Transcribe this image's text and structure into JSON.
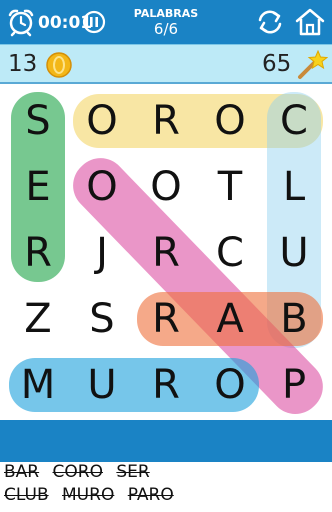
{
  "header": {
    "timer": "00:01",
    "label": "PALABRAS",
    "progress": "6/6"
  },
  "stats": {
    "coins": "13",
    "hints": "65"
  },
  "grid": {
    "rows": [
      [
        "S",
        "O",
        "R",
        "O",
        "C"
      ],
      [
        "E",
        "O",
        "O",
        "T",
        "L"
      ],
      [
        "R",
        "J",
        "R",
        "C",
        "U"
      ],
      [
        "Z",
        "S",
        "R",
        "A",
        "B"
      ],
      [
        "M",
        "U",
        "R",
        "O",
        "P"
      ]
    ]
  },
  "highlights": [
    {
      "word": "SER",
      "color": "#2eaa55"
    },
    {
      "word": "CORO",
      "color": "#f2cd4a"
    },
    {
      "word": "CLUB",
      "color": "#8fd0ef"
    },
    {
      "word": "PARO",
      "color": "#d9409b"
    },
    {
      "word": "BAR",
      "color": "#ee6f3a"
    },
    {
      "word": "MURO",
      "color": "#1aa0dc"
    }
  ],
  "words": {
    "row1": [
      "BAR",
      "CORO",
      "SER"
    ],
    "row2": [
      "CLUB",
      "MURO",
      "PARO"
    ]
  }
}
